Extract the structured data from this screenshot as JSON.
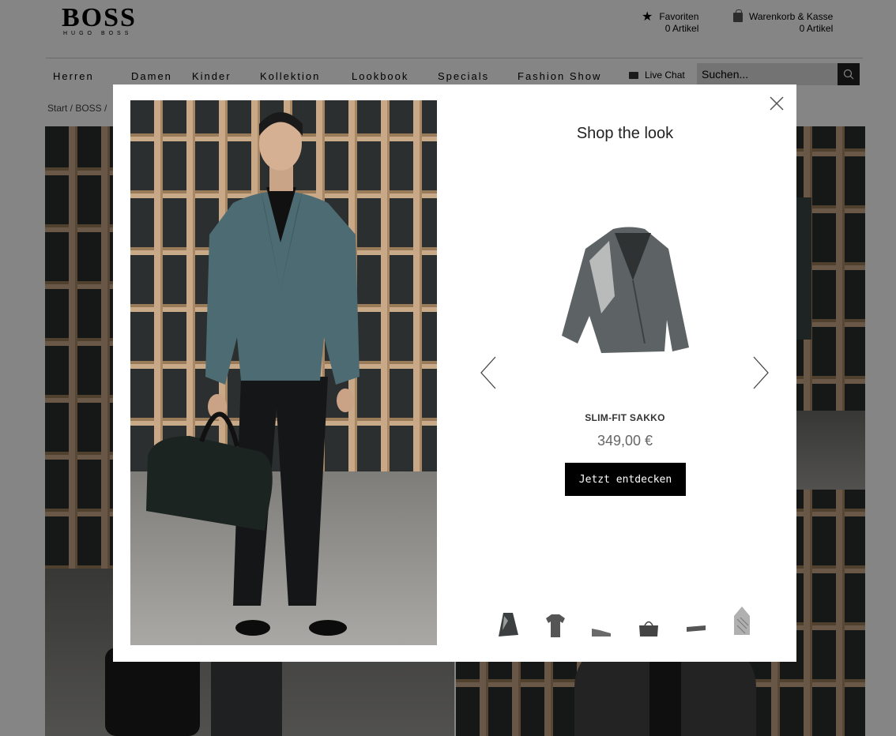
{
  "brand": {
    "logo_main": "BOSS",
    "logo_sub": "HUGO BOSS"
  },
  "header": {
    "favorites_label": "Favoriten",
    "favorites_count": "0 Artikel",
    "cart_label": "Warenkorb & Kasse",
    "cart_count": "0 Artikel"
  },
  "nav": {
    "items": [
      "Herren",
      "Damen",
      "Kinder",
      "Kollektion",
      "Lookbook",
      "Specials",
      "Fashion Show"
    ],
    "live_chat": "Live Chat",
    "search_placeholder": "Suchen..."
  },
  "breadcrumb": "Start / BOSS /",
  "modal": {
    "title": "Shop the look",
    "product_name": "SLIM-FIT SAKKO",
    "product_price": "349,00 €",
    "cta_label": "Jetzt entdecken",
    "thumbnails": [
      {
        "name": "jacket-thumbnail",
        "active": true
      },
      {
        "name": "tshirt-thumbnail",
        "active": false
      },
      {
        "name": "sneaker-thumbnail",
        "active": false
      },
      {
        "name": "bag-thumbnail",
        "active": false
      },
      {
        "name": "belt-thumbnail",
        "active": false
      },
      {
        "name": "pocket-square-thumbnail",
        "active": false
      }
    ]
  },
  "icons": {
    "favorites": "star-icon",
    "cart": "shopping-bag-icon",
    "live_chat": "chat-bubble-icon",
    "search": "search-icon",
    "close": "close-icon",
    "prev": "chevron-left-icon",
    "next": "chevron-right-icon"
  },
  "colors": {
    "overlay": "#000000",
    "cta_background": "#000000",
    "cta_text": "#ffffff",
    "search_button": "#222222"
  }
}
